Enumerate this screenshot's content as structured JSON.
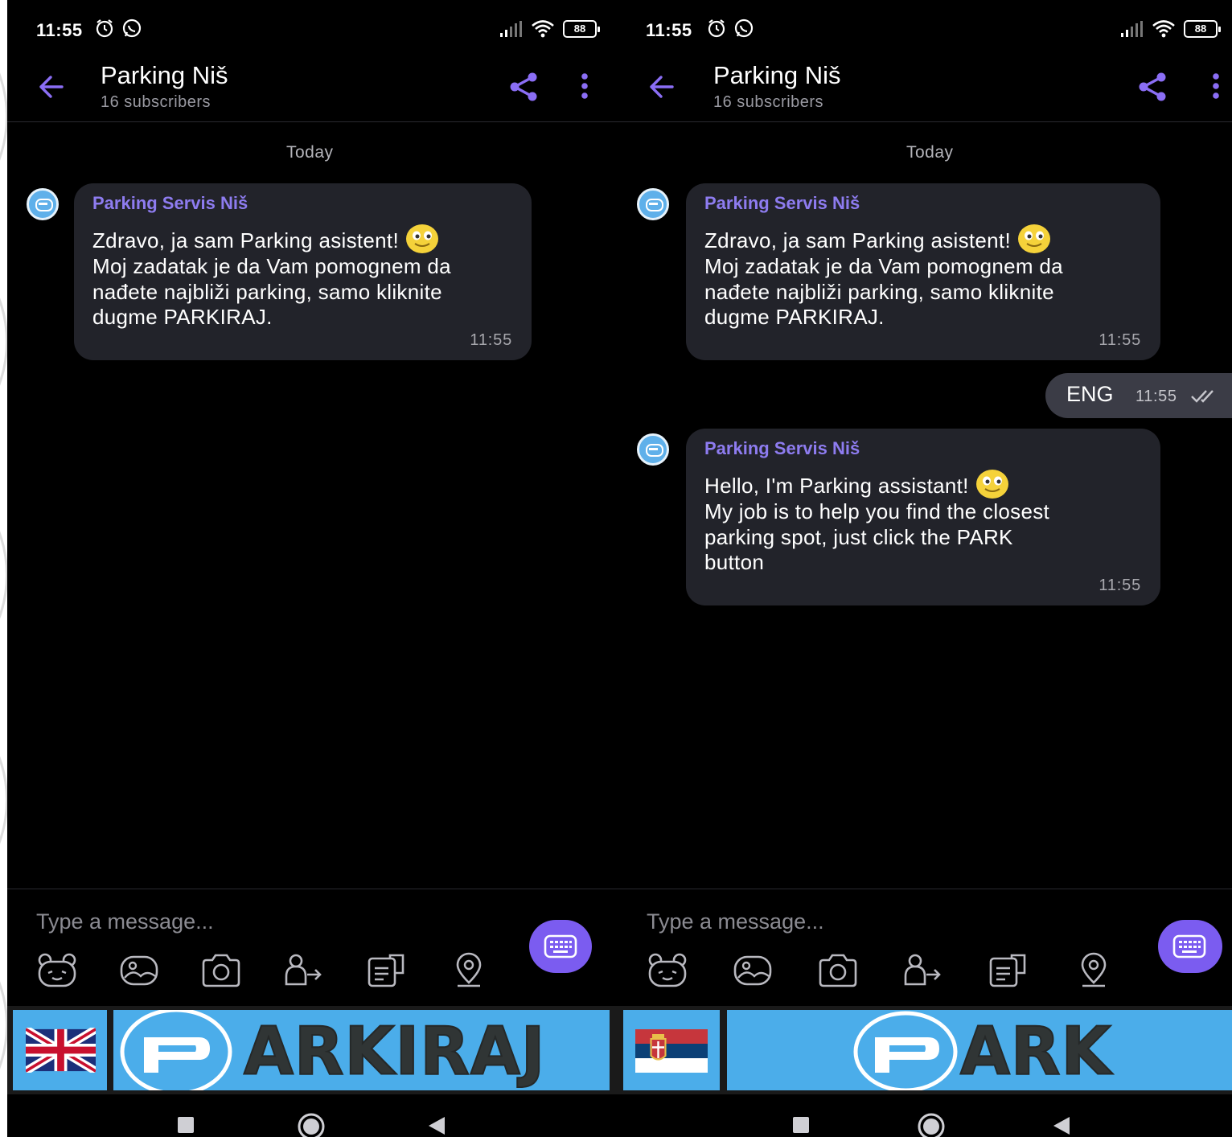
{
  "status_bar": {
    "time": "11:55",
    "battery": "88"
  },
  "chat": {
    "title": "Parking Niš",
    "subtitle": "16 subscribers",
    "date_separator": "Today",
    "sender": "Parking Servis Niš"
  },
  "messages": {
    "serbian": {
      "lines": [
        "Zdravo, ja sam Parking asistent!",
        "Moj zadatak je da Vam pomognem da",
        "nađete najbliži parking, samo kliknite",
        "dugme PARKIRAJ."
      ],
      "time": "11:55"
    },
    "outgoing": {
      "text": "ENG",
      "time": "11:55"
    },
    "english": {
      "lines": [
        "Hello, I'm Parking assistant!",
        "My job is to help you find the closest",
        "parking spot, just click the PARK",
        "button"
      ],
      "time": "11:55"
    }
  },
  "composer": {
    "placeholder": "Type a message..."
  },
  "bottom_buttons": {
    "left": {
      "flag": "uk-flag-icon",
      "label": "ARKIRAJ"
    },
    "right": {
      "flag": "serbia-flag-icon",
      "label": "ARK"
    }
  },
  "icons": {
    "header": [
      "back-arrow-icon",
      "share-icon",
      "more-icon"
    ],
    "composer_tools": [
      "sticker-icon",
      "gallery-icon",
      "camera-icon",
      "contact-icon",
      "gif-icon",
      "location-icon"
    ],
    "nav": [
      "recents-icon",
      "home-icon",
      "back-icon"
    ]
  },
  "colors": {
    "accent": "#7b5cf0",
    "sender": "#8e7cf0",
    "bubble": "#22232a",
    "button_blue": "#4badea"
  }
}
